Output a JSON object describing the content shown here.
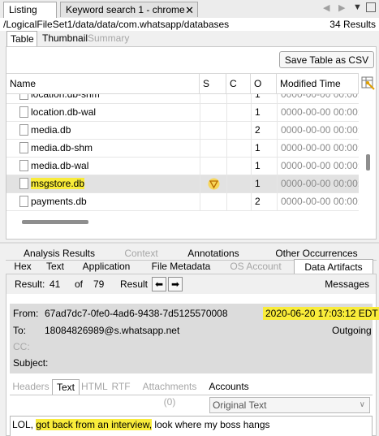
{
  "top_tabs": [
    {
      "label": "Listing"
    },
    {
      "label": "Keyword search 1 - chrome",
      "close": "✕"
    }
  ],
  "path": "/LogicalFileSet1/data/data/com.whatsapp/databases",
  "results_count": "34 Results",
  "view_tabs": [
    "Table",
    "Thumbnail",
    "Summary"
  ],
  "save_csv_label": "Save Table as CSV",
  "columns": [
    "Name",
    "S",
    "C",
    "O",
    "Modified Time"
  ],
  "rows": [
    {
      "name": "location.db-shm",
      "o": "1",
      "modified": "0000-00-00 00:00:00"
    },
    {
      "name": "location.db-wal",
      "o": "1",
      "modified": "0000-00-00 00:00:00"
    },
    {
      "name": "media.db",
      "o": "2",
      "modified": "0000-00-00 00:00:00"
    },
    {
      "name": "media.db-shm",
      "o": "1",
      "modified": "0000-00-00 00:00:00"
    },
    {
      "name": "media.db-wal",
      "o": "1",
      "modified": "0000-00-00 00:00:00"
    },
    {
      "name": "msgstore.db",
      "o": "1",
      "modified": "0000-00-00 00:00:00",
      "selected": true,
      "score_icon": "warning-triangle-icon"
    },
    {
      "name": "payments.db",
      "o": "2",
      "modified": "0000-00-00 00:00:00"
    }
  ],
  "lower_tabs_row1": [
    "Analysis Results",
    "Context",
    "Annotations",
    "Other Occurrences"
  ],
  "lower_tabs_row2": [
    "Hex",
    "Text",
    "Application",
    "File Metadata",
    "OS Account",
    "Data Artifacts"
  ],
  "result_nav": {
    "label": "Result:",
    "current": "41",
    "of_label": "of",
    "total": "79",
    "result_label": "Result",
    "category": "Messages"
  },
  "message": {
    "from_label": "From:",
    "from": "67ad7dc7-0fe0-4ad6-9438-7d5125570008",
    "timestamp": "2020-06-20 17:03:12 EDT",
    "to_label": "To:",
    "to": "18084826989@s.whatsapp.net",
    "direction": "Outgoing",
    "cc_label": "CC:",
    "subject_label": "Subject:",
    "body_prefix": "LOL, ",
    "body_highlight": "got back from an interview,",
    "body_suffix": " look where my boss hangs"
  },
  "inner_tabs": [
    "Headers",
    "Text",
    "HTML",
    "RTF",
    "Attachments (0)",
    "Accounts"
  ],
  "text_format": "Original Text",
  "colors": {
    "highlight": "#f9ec3a",
    "selected_row": "#e2e2e2",
    "header_box": "#dcdcdc"
  }
}
